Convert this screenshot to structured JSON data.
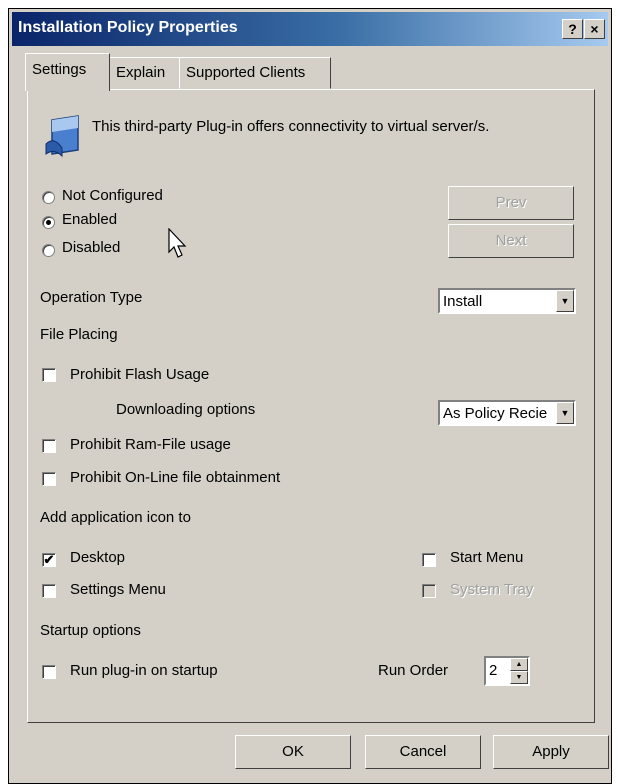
{
  "window": {
    "title": "Installation Policy Properties",
    "help_button": "?",
    "close_button": "×"
  },
  "tabs": [
    {
      "label": "Settings",
      "active": true
    },
    {
      "label": "Explain",
      "active": false
    },
    {
      "label": "Supported Clients",
      "active": false
    }
  ],
  "plugin": {
    "icon": "plugin-icon",
    "description": "This third-party Plug-in offers connectivity to virtual server/s."
  },
  "state_radios": {
    "selected": "Enabled",
    "options": [
      "Not Configured",
      "Enabled",
      "Disabled"
    ]
  },
  "nav_buttons": {
    "prev": "Prev",
    "next": "Next"
  },
  "operation_type": {
    "label": "Operation Type",
    "value": "Install"
  },
  "file_placing": {
    "label": "File Placing"
  },
  "options": {
    "prohibit_flash": {
      "label": "Prohibit Flash Usage",
      "checked": false
    },
    "downloading_label": "Downloading options",
    "downloading_value": "As Policy Recie",
    "prohibit_ram": {
      "label": "Prohibit Ram-File usage",
      "checked": false
    },
    "prohibit_online": {
      "label": "Prohibit On-Line file obtainment",
      "checked": false
    }
  },
  "add_icon": {
    "label": "Add application icon to",
    "desktop": {
      "label": "Desktop",
      "checked": true
    },
    "start_menu": {
      "label": "Start Menu",
      "checked": false
    },
    "settings_menu": {
      "label": "Settings Menu",
      "checked": false
    },
    "system_tray": {
      "label": "System Tray",
      "checked": false,
      "disabled": true
    }
  },
  "startup": {
    "label": "Startup options",
    "run_on_startup": {
      "label": "Run plug-in on startup",
      "checked": false
    },
    "run_order_label": "Run Order",
    "run_order_value": "2"
  },
  "footer": {
    "ok": "OK",
    "cancel": "Cancel",
    "apply": "Apply"
  },
  "colors": {
    "title_gradient_start": "#0a246a",
    "title_gradient_end": "#a6caf0",
    "face": "#d4d0c8"
  }
}
